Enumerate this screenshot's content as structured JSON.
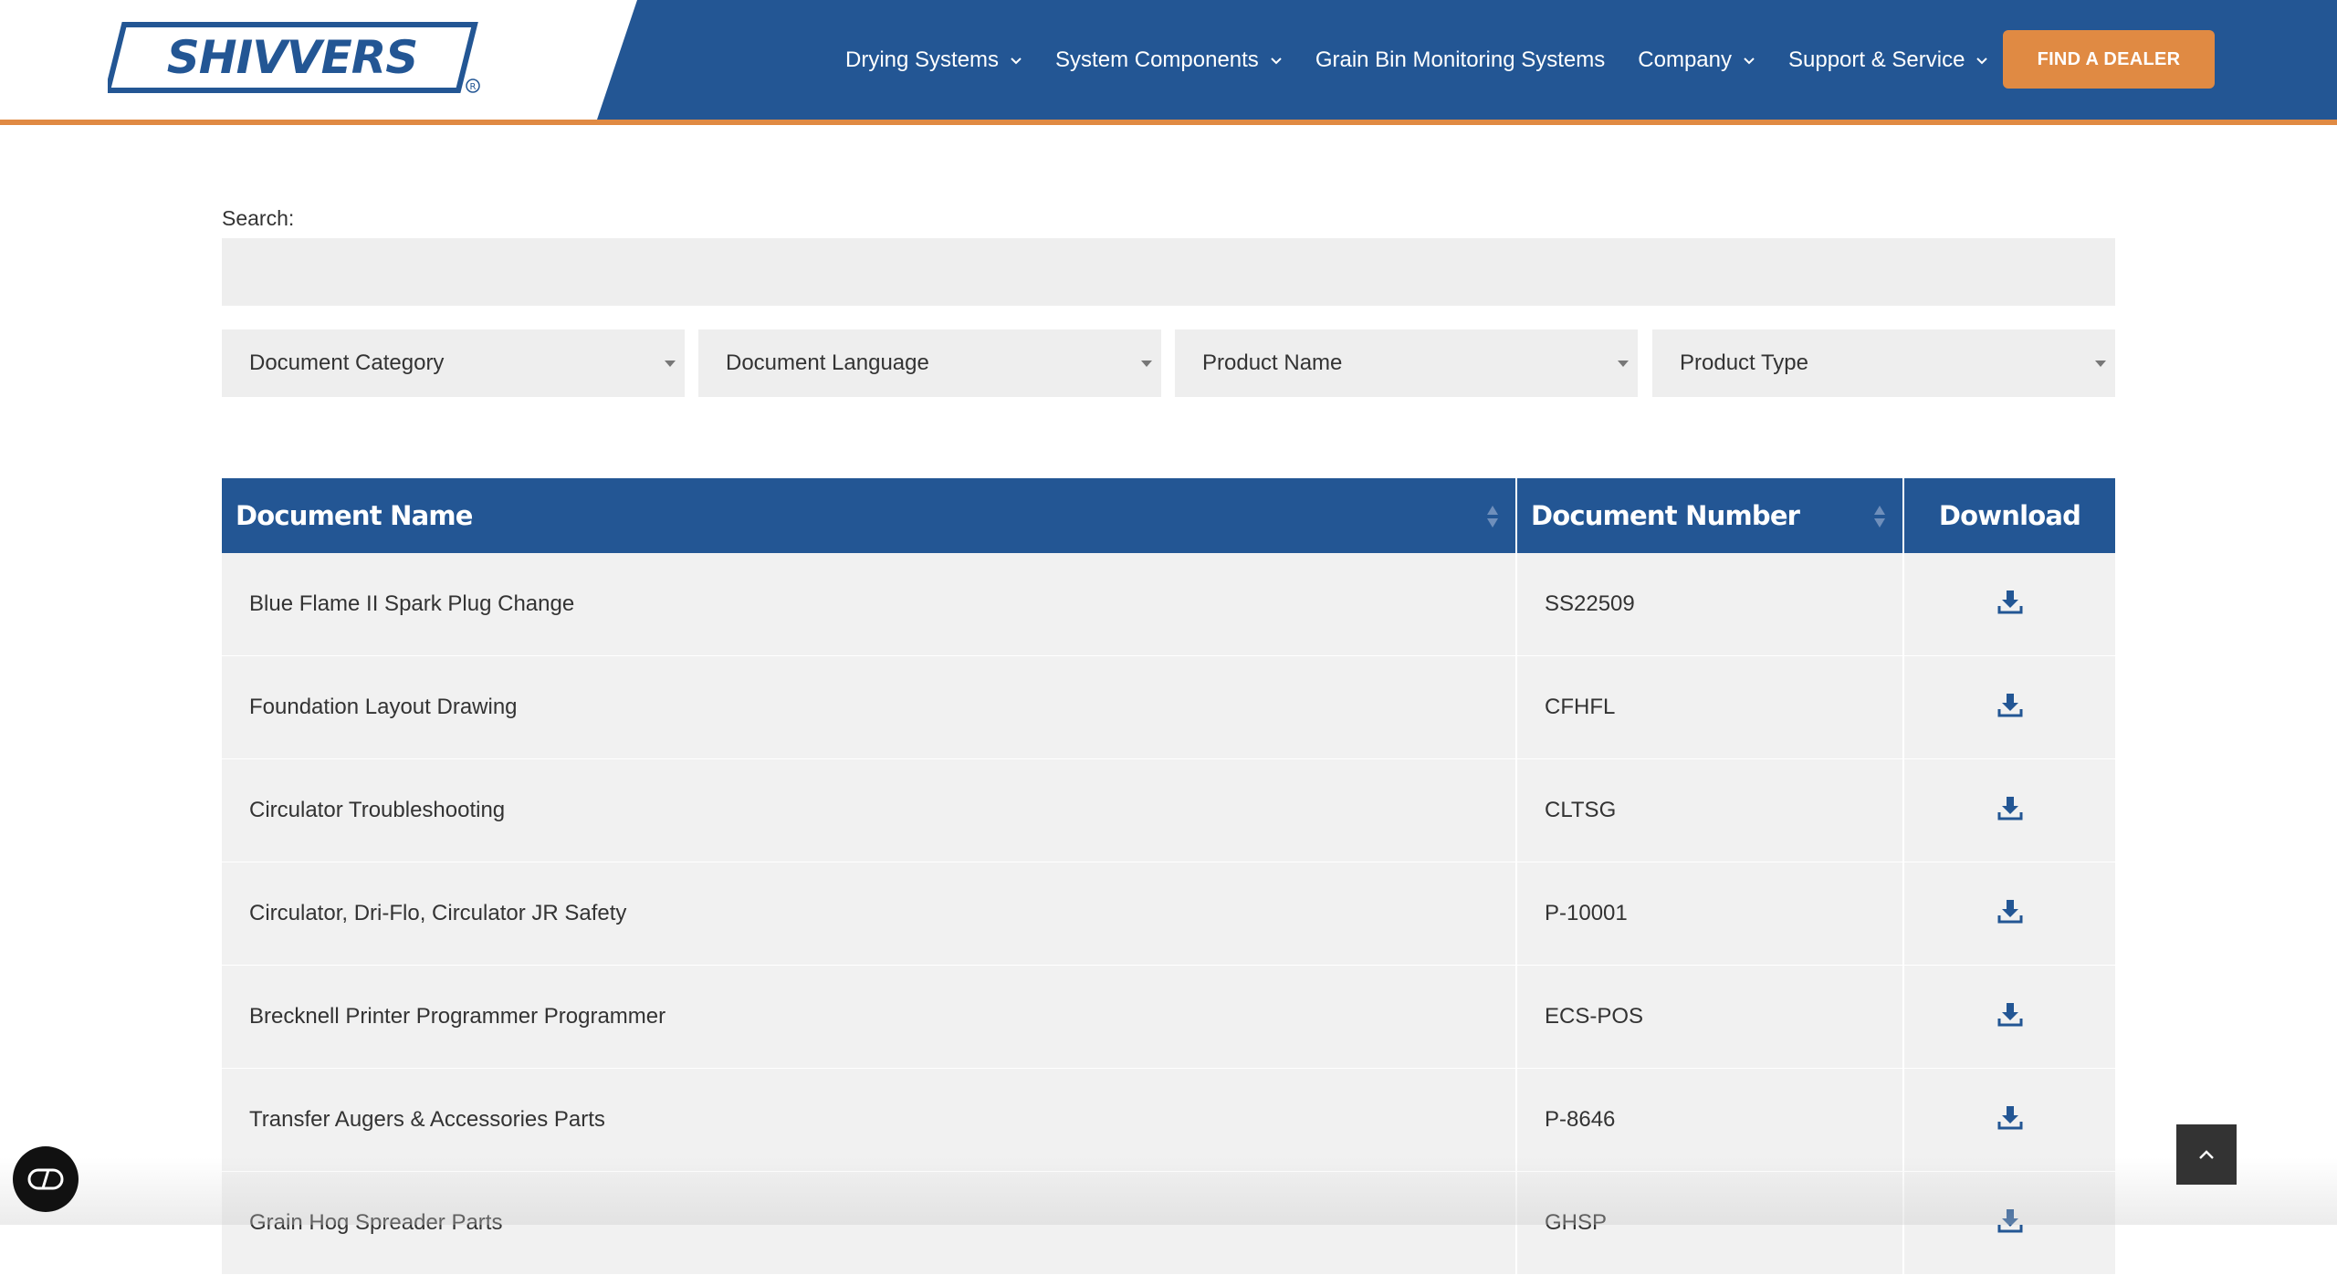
{
  "header": {
    "logo_text": "SHIVVERS",
    "nav": [
      {
        "label": "Drying Systems",
        "has_dropdown": true
      },
      {
        "label": "System Components",
        "has_dropdown": true
      },
      {
        "label": "Grain Bin Monitoring Systems",
        "has_dropdown": false
      },
      {
        "label": "Company",
        "has_dropdown": true
      },
      {
        "label": "Support & Service",
        "has_dropdown": true
      }
    ],
    "cta_label": "FIND A DEALER"
  },
  "search": {
    "label": "Search:",
    "value": "",
    "placeholder": ""
  },
  "filters": [
    {
      "label": "Document Category"
    },
    {
      "label": "Document Language"
    },
    {
      "label": "Product Name"
    },
    {
      "label": "Product Type"
    }
  ],
  "table": {
    "columns": [
      "Document Name",
      "Document Number",
      "Download"
    ],
    "rows": [
      {
        "name": "Blue Flame II Spark Plug Change",
        "number": "SS22509"
      },
      {
        "name": "Foundation Layout Drawing",
        "number": "CFHFL"
      },
      {
        "name": "Circulator Troubleshooting",
        "number": "CLTSG"
      },
      {
        "name": "Circulator, Dri-Flo, Circulator JR Safety",
        "number": "P-10001"
      },
      {
        "name": "Brecknell Printer Programmer Programmer",
        "number": "ECS-POS"
      },
      {
        "name": "Transfer Augers & Accessories Parts",
        "number": "P-8646"
      },
      {
        "name": "Grain Hog Spreader Parts",
        "number": "GHSP"
      }
    ]
  },
  "colors": {
    "brand_blue": "#235694",
    "accent_orange": "#e08a43",
    "row_bg": "#f1f1f1"
  },
  "icons": {
    "download": "download-icon",
    "back_to_top": "chevron-up-icon",
    "accessibility": "accessibility-toggle-icon"
  }
}
